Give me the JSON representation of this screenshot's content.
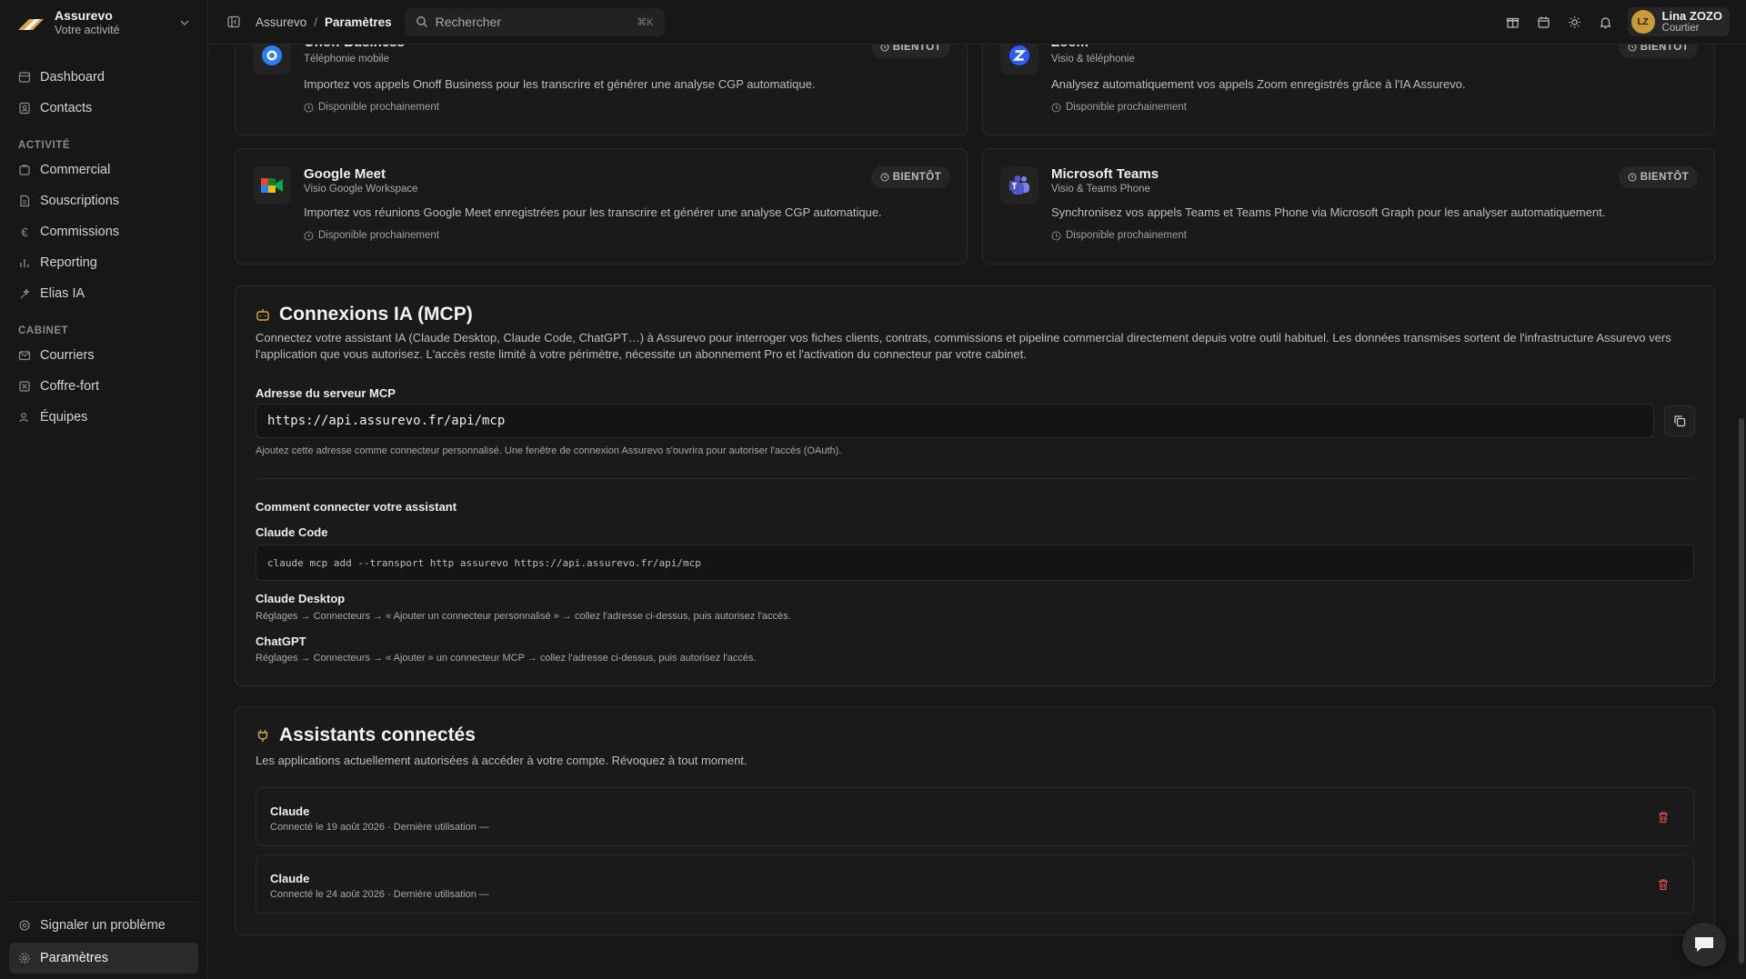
{
  "app": {
    "name": "Assurevo",
    "subtitle": "Votre activité"
  },
  "sidebar": {
    "top_items": [
      {
        "label": "Dashboard",
        "icon": "dashboard-icon"
      },
      {
        "label": "Contacts",
        "icon": "contacts-icon"
      }
    ],
    "section_activity": "ACTIVITÉ",
    "activity_items": [
      {
        "label": "Commercial",
        "icon": "commercial-icon"
      },
      {
        "label": "Souscriptions",
        "icon": "document-icon"
      },
      {
        "label": "Commissions",
        "icon": "euro-icon"
      },
      {
        "label": "Reporting",
        "icon": "bar-chart-icon"
      },
      {
        "label": "Elias IA",
        "icon": "sparkles-icon"
      }
    ],
    "section_cabinet": "CABINET",
    "cabinet_items": [
      {
        "label": "Courriers",
        "icon": "mail-icon"
      },
      {
        "label": "Coffre-fort",
        "icon": "vault-icon"
      },
      {
        "label": "Équipes",
        "icon": "users-icon"
      }
    ],
    "bottom_items": [
      {
        "label": "Signaler un problème",
        "icon": "bug-icon"
      },
      {
        "label": "Paramètres",
        "icon": "gear-icon",
        "active": true
      }
    ]
  },
  "topbar": {
    "breadcrumb_root": "Assurevo",
    "breadcrumb_sep": "/",
    "breadcrumb_current": "Paramètres",
    "search_placeholder": "Rechercher",
    "search_shortcut": "⌘K",
    "user_initials": "LZ",
    "user_name": "Lina ZOZO",
    "user_role": "Courtier"
  },
  "integrations": [
    {
      "title": "Onoff Business",
      "subtitle": "Téléphonie mobile",
      "description": "Importez vos appels Onoff Business pour les transcrire et générer une analyse CGP automatique.",
      "availability": "Disponible prochainement",
      "badge": "BIENTÔT"
    },
    {
      "title": "Zoom",
      "subtitle": "Visio & téléphonie",
      "description": "Analysez automatiquement vos appels Zoom enregistrés grâce à l'IA Assurevo.",
      "availability": "Disponible prochainement",
      "badge": "BIENTÔT"
    },
    {
      "title": "Google Meet",
      "subtitle": "Visio Google Workspace",
      "description": "Importez vos réunions Google Meet enregistrées pour les transcrire et générer une analyse CGP automatique.",
      "availability": "Disponible prochainement",
      "badge": "BIENTÔT"
    },
    {
      "title": "Microsoft Teams",
      "subtitle": "Visio & Teams Phone",
      "description": "Synchronisez vos appels Teams et Teams Phone via Microsoft Graph pour les analyser automatiquement.",
      "availability": "Disponible prochainement",
      "badge": "BIENTÔT"
    }
  ],
  "mcp": {
    "title": "Connexions IA (MCP)",
    "description": "Connectez votre assistant IA (Claude Desktop, Claude Code, ChatGPT…) à Assurevo pour interroger vos fiches clients, contrats, commissions et pipeline commercial directement depuis votre outil habituel. Les données transmises sortent de l'infrastructure Assurevo vers l'application que vous autorisez. L'accès reste limité à votre périmètre, nécessite un abonnement Pro et l'activation du connecteur par votre cabinet.",
    "server_label": "Adresse du serveur MCP",
    "server_url": "https://api.assurevo.fr/api/mcp",
    "server_help": "Ajoutez cette adresse comme connecteur personnalisé. Une fenêtre de connexion Assurevo s'ouvrira pour autoriser l'accès (OAuth).",
    "howto_title": "Comment connecter votre assistant",
    "claude_code_label": "Claude Code",
    "claude_code_cmd": "claude mcp add --transport http assurevo https://api.assurevo.fr/api/mcp",
    "claude_desktop_label": "Claude Desktop",
    "claude_desktop_text": "Réglages → Connecteurs → « Ajouter un connecteur personnalisé » → collez l'adresse ci-dessus, puis autorisez l'accès.",
    "chatgpt_label": "ChatGPT",
    "chatgpt_text": "Réglages → Connecteurs → « Ajouter » un connecteur MCP → collez l'adresse ci-dessus, puis autorisez l'accès."
  },
  "assistants": {
    "title": "Assistants connectés",
    "description": "Les applications actuellement autorisées à accéder à votre compte. Révoquez à tout moment.",
    "items": [
      {
        "name": "Claude",
        "meta": "Connecté le 19 août 2026 · Dernière utilisation —"
      },
      {
        "name": "Claude",
        "meta": "Connecté le 24 août 2026 · Dernière utilisation —"
      }
    ]
  },
  "colors": {
    "accent": "#e0a53a",
    "danger": "#e04b4b",
    "background": "#171717"
  }
}
